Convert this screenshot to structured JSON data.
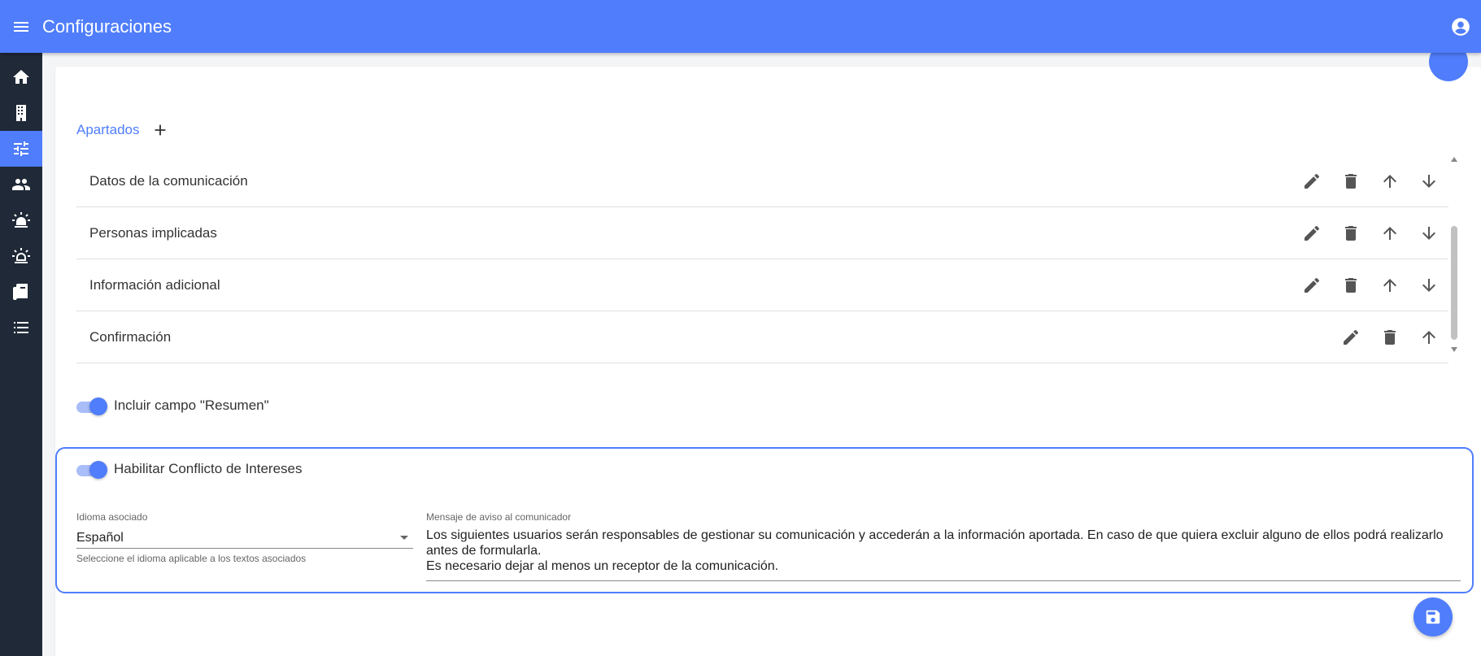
{
  "header": {
    "title": "Configuraciones",
    "menu_icon": "menu-icon",
    "account_icon": "account-circle-icon"
  },
  "sidebar": {
    "items": [
      {
        "icon": "home-icon",
        "active": false
      },
      {
        "icon": "building-icon",
        "active": false
      },
      {
        "icon": "tune-icon",
        "active": true
      },
      {
        "icon": "people-icon",
        "active": false
      },
      {
        "icon": "alarm-light-icon",
        "active": false
      },
      {
        "icon": "alarm-light-outline-icon",
        "active": false
      },
      {
        "icon": "book-icon",
        "active": false
      },
      {
        "icon": "list-icon",
        "active": false
      }
    ]
  },
  "apartados": {
    "title": "Apartados",
    "items": [
      {
        "label": "Datos de la comunicación"
      },
      {
        "label": "Personas implicadas"
      },
      {
        "label": "Información adicional"
      },
      {
        "label": "Confirmación"
      }
    ]
  },
  "toggles": {
    "resumen": {
      "label": "Incluir campo \"Resumen\"",
      "on": true
    },
    "conflicto": {
      "label": "Habilitar Conflicto de Intereses",
      "on": true
    }
  },
  "idioma": {
    "label": "Idioma asociado",
    "value": "Español",
    "hint": "Seleccione el idioma aplicable a los textos asociados"
  },
  "mensaje": {
    "label": "Mensaje de aviso al comunicador",
    "value": "Los siguientes usuarios serán responsables de gestionar su comunicación y accederán a la información aportada. En caso de que quiera excluir alguno de ellos podrá realizarlo antes de formularla.\nEs necesario dejar al menos un receptor de la comunicación."
  },
  "colors": {
    "accent": "#4f7dfb",
    "sidebar": "#1f2937"
  }
}
